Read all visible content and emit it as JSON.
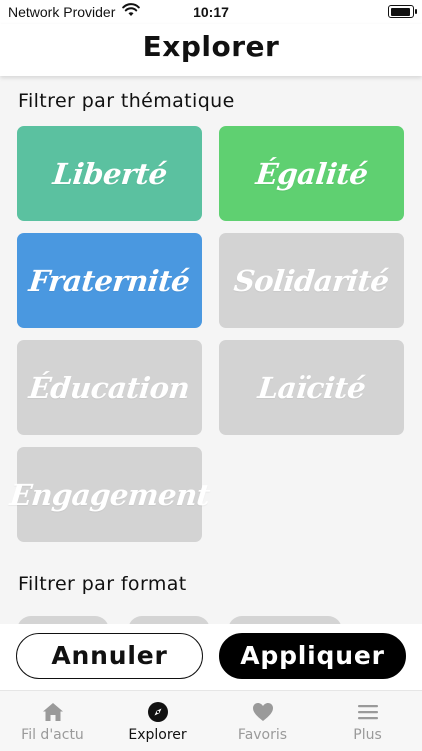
{
  "status_bar": {
    "carrier": "Network Provider",
    "time": "10:17"
  },
  "header": {
    "title": "Explorer"
  },
  "filters": {
    "thematic_label": "Filtrer par thématique",
    "format_label": "Filtrer par format",
    "themes": [
      {
        "label": "Liberté",
        "color": "#5BC1A0",
        "selected": true
      },
      {
        "label": "Égalité",
        "color": "#5FD071",
        "selected": true
      },
      {
        "label": "Fraternité",
        "color": "#4A98E0",
        "selected": true
      },
      {
        "label": "Solidarité",
        "color": "#D3D3D3",
        "selected": false
      },
      {
        "label": "Éducation",
        "color": "#D3D3D3",
        "selected": false
      },
      {
        "label": "Laïcité",
        "color": "#D3D3D3",
        "selected": false
      },
      {
        "label": "Engagement",
        "color": "#D3D3D3",
        "selected": false
      }
    ]
  },
  "actions": {
    "cancel_label": "Annuler",
    "apply_label": "Appliquer"
  },
  "tab_bar": {
    "items": [
      {
        "label": "Fil d'actu",
        "icon": "home-icon",
        "active": false
      },
      {
        "label": "Explorer",
        "icon": "compass-icon",
        "active": true
      },
      {
        "label": "Favoris",
        "icon": "heart-icon",
        "active": false
      },
      {
        "label": "Plus",
        "icon": "menu-icon",
        "active": false
      }
    ]
  }
}
